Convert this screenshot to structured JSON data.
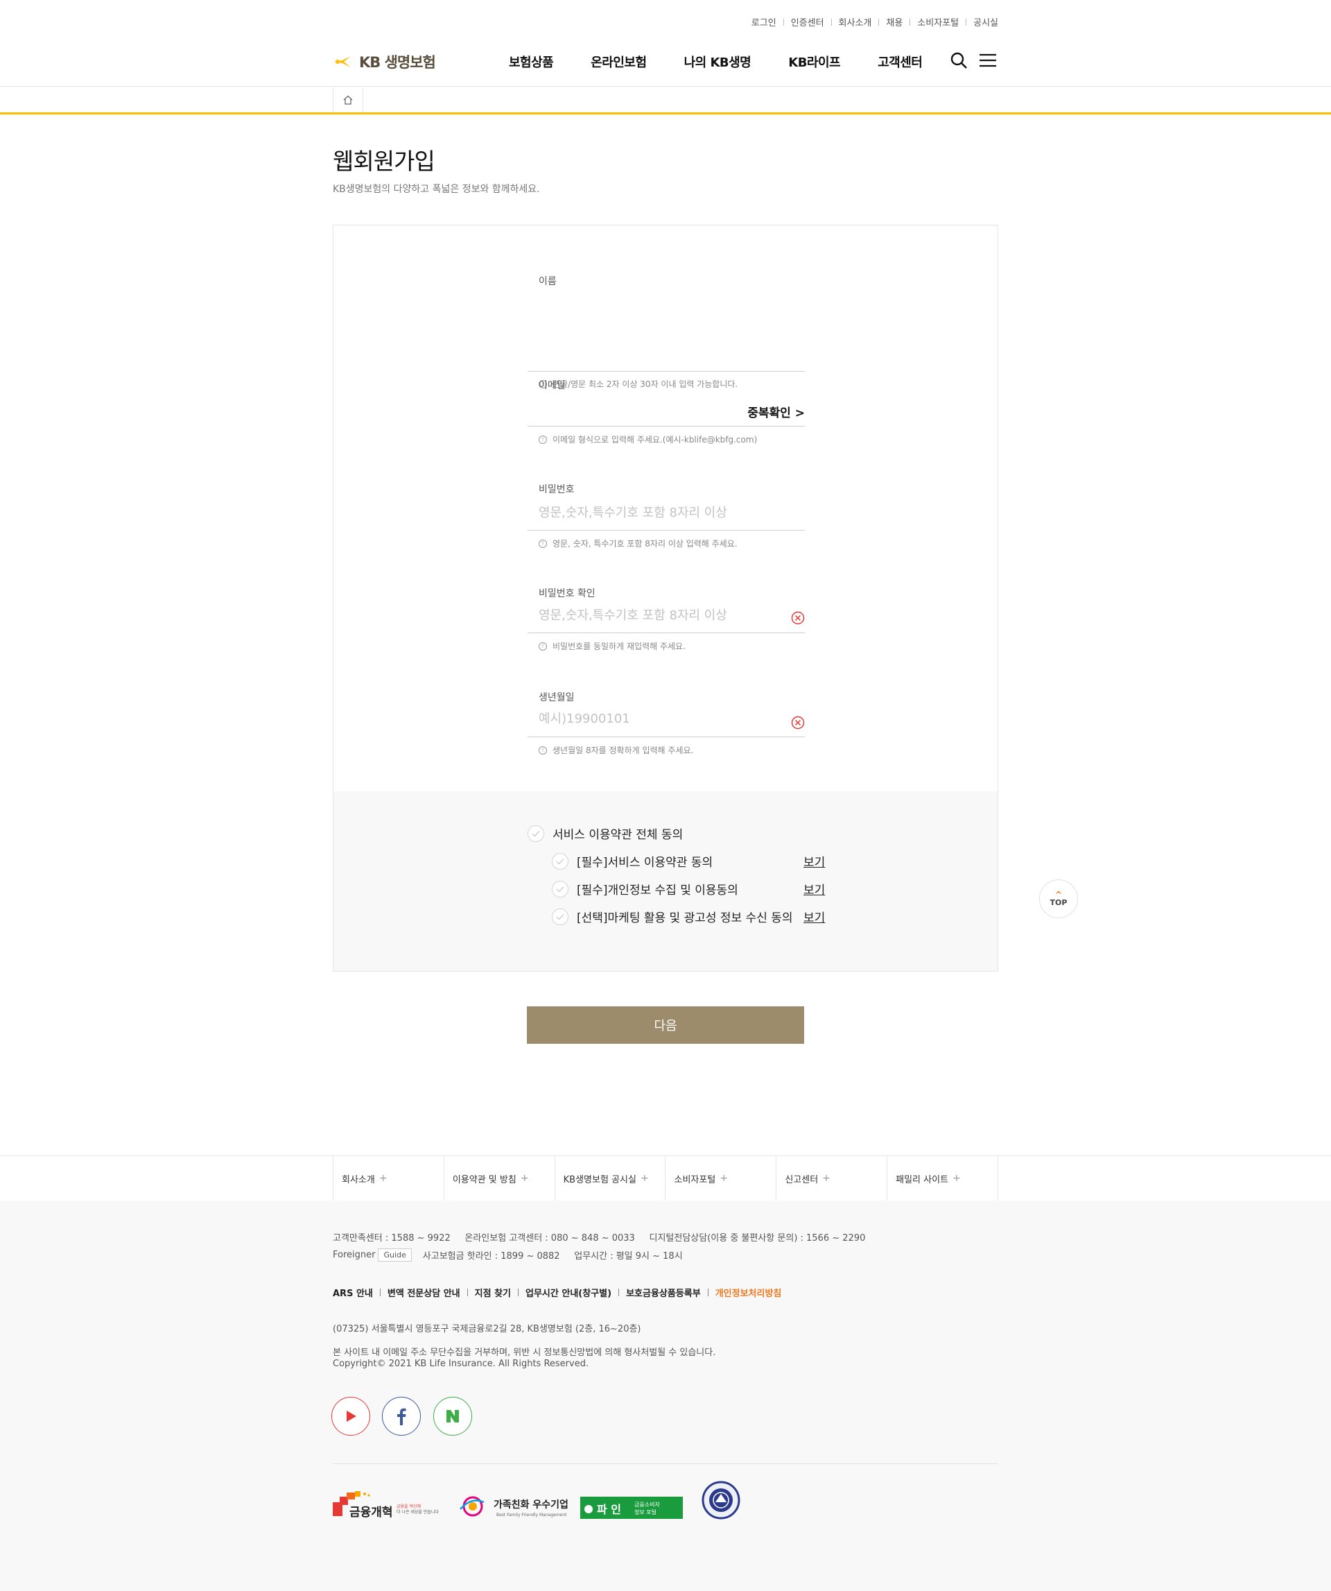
{
  "util": [
    "로그인",
    "인증센터",
    "회사소개",
    "채용",
    "소비자포털",
    "공시실"
  ],
  "logo": {
    "text": "KB 생명보험"
  },
  "gnb": [
    "보험상품",
    "온라인보험",
    "나의 KB생명",
    "KB라이프",
    "고객센터"
  ],
  "page": {
    "title": "웹회원가입",
    "desc": "KB생명보험의 다양하고 폭넓은 정보와 함께하세요."
  },
  "form": {
    "name": {
      "label": "이름",
      "hint": "한글/영문 최소 2자 이상 30자 이내 입력 가능합니다."
    },
    "email": {
      "label": "이메일",
      "dup": "중복확인 >",
      "hint": "이메일 형식으로 입력해 주세요.(예시-kblife@kbfg.com)"
    },
    "password": {
      "label": "비밀번호",
      "placeholder": "영문,숫자,특수기호 포함 8자리 이상",
      "hint": "영문, 숫자, 특수기호 포함 8자리 이상 입력해 주세요."
    },
    "password_confirm": {
      "label": "비밀번호 확인",
      "placeholder": "영문,숫자,특수기호 포함 8자리 이상",
      "hint": "비밀번호를 동일하게 재입력해 주세요."
    },
    "birth": {
      "label": "생년월일",
      "placeholder": "예시)19900101",
      "hint": "생년월일 8자를 정확하게 입력해 주세요."
    }
  },
  "agree": {
    "all": "서비스 이용약관 전체 동의",
    "items": [
      {
        "label": "[필수]서비스 이용약관 동의",
        "view": "보기"
      },
      {
        "label": "[필수]개인정보 수집 및 이용동의",
        "view": "보기"
      },
      {
        "label": "[선택]마케팅 활용 및 광고성 정보 수신 동의",
        "view": "보기"
      }
    ]
  },
  "next_button": "다음",
  "top_button": "TOP",
  "footer": {
    "nav": [
      "회사소개",
      "이용약관 및 방침",
      "KB생명보험 공시실",
      "소비자포털",
      "신고센터",
      "패밀리 사이트"
    ],
    "contact1": "고객만족센터 : 1588 ~ 9922     온라인보험 고객센터 : 080 ~ 848 ~ 0033     디지털전담상담(이용 중 불편사항 문의) : 1566 ~ 2290",
    "foreigner": "Foreigner",
    "guide": "Guide",
    "contact2": "사고보험금 핫라인 : 1899 ~ 0882     업무시간 : 평일 9시 ~ 18시",
    "links": [
      "ARS 안내",
      "변액 전문상담 안내",
      "지점 찾기",
      "업무시간 안내(창구별)",
      "보호금융상품등록부",
      "개인정보처리방침"
    ],
    "address": "(07325) 서울특별시 영등포구 국제금융로2길 28, KB생명보험 (2층, 16~20층)",
    "notice": "본 사이트 내 이메일 주소 무단수집을 거부하며, 위반 시 정보통신망법에 의해 형사처벌될 수 있습니다.",
    "copyright": "Copyright© 2021 KB Life Insurance. All Rights Reserved."
  },
  "colors": {
    "accent": "#ffbc00",
    "button": "#9d8c6c",
    "highlight": "#f07820"
  }
}
